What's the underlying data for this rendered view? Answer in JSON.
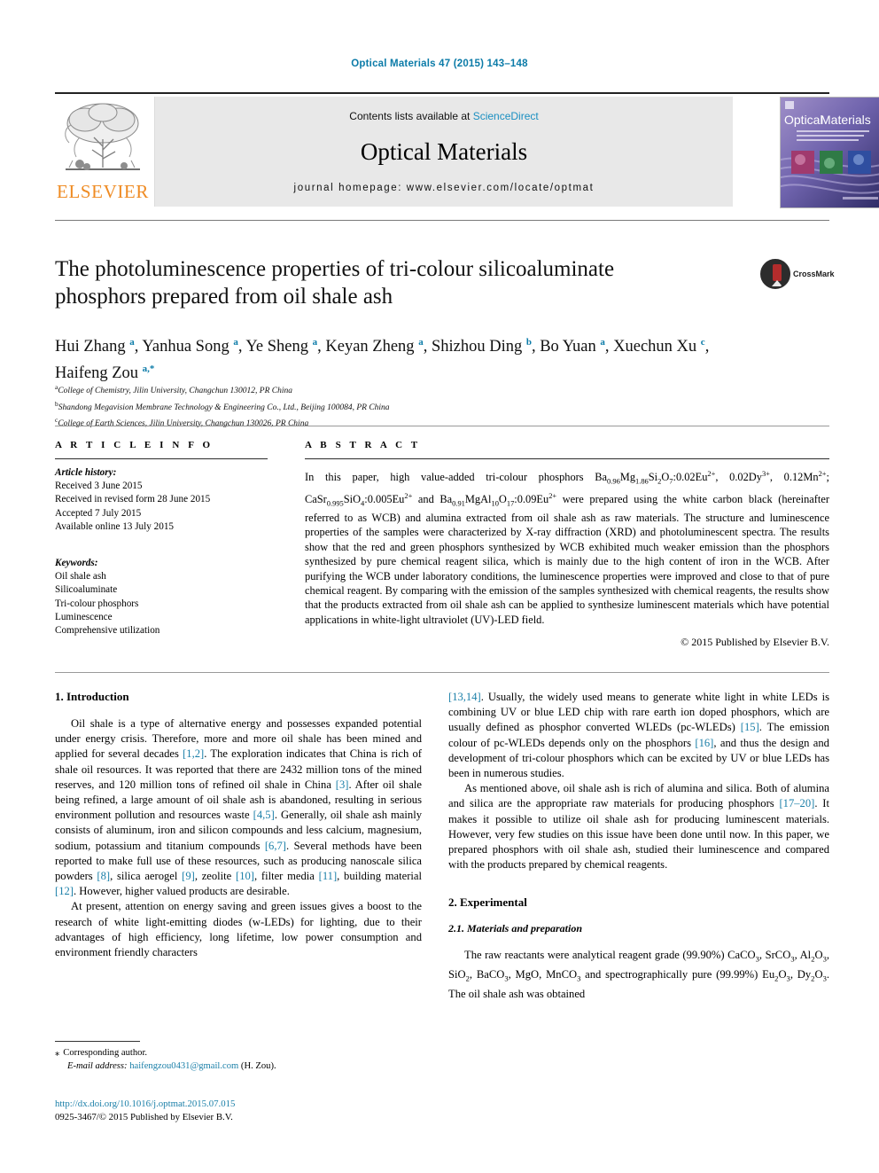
{
  "running_head": "Optical Materials 47 (2015) 143–148",
  "masthead": {
    "publisher": "ELSEVIER",
    "contents_prefix": "Contents lists available at ",
    "contents_link": "ScienceDirect",
    "journal_title": "Optical Materials",
    "homepage": "journal homepage: www.elsevier.com/locate/optmat",
    "cover_title": "Optical Materials"
  },
  "article": {
    "title": "The photoluminescence properties of tri-colour silicoaluminate phosphors prepared from oil shale ash",
    "crossmark_label": "CrossMark",
    "authors": [
      {
        "name": "Hui Zhang",
        "marks": "a"
      },
      {
        "name": "Yanhua Song",
        "marks": "a"
      },
      {
        "name": "Ye Sheng",
        "marks": "a"
      },
      {
        "name": "Keyan Zheng",
        "marks": "a"
      },
      {
        "name": "Shizhou Ding",
        "marks": "b"
      },
      {
        "name": "Bo Yuan",
        "marks": "a"
      },
      {
        "name": "Xuechun Xu",
        "marks": "c"
      },
      {
        "name": "Haifeng Zou",
        "marks": "a,*"
      }
    ],
    "affiliations": [
      {
        "mark": "a",
        "text": "College of Chemistry, Jilin University, Changchun 130012, PR China"
      },
      {
        "mark": "b",
        "text": "Shandong Megavision Membrane Technology & Engineering Co., Ltd., Beijing 100084, PR China"
      },
      {
        "mark": "c",
        "text": "College of Earth Sciences, Jilin University, Changchun 130026, PR China"
      }
    ]
  },
  "article_info": {
    "heading": "A R T I C L E   I N F O",
    "history_label": "Article history:",
    "history": [
      "Received 3 June 2015",
      "Received in revised form 28 June 2015",
      "Accepted 7 July 2015",
      "Available online 13 July 2015"
    ],
    "keywords_label": "Keywords:",
    "keywords": [
      "Oil shale ash",
      "Silicoaluminate",
      "Tri-colour phosphors",
      "Luminescence",
      "Comprehensive utilization"
    ]
  },
  "abstract": {
    "heading": "A B S T R A C T",
    "text_parts": [
      "In this paper, high value-added tri-colour phosphors Ba",
      "0.96",
      "Mg",
      "1.86",
      "Si",
      "2",
      "O",
      "7",
      ":0.02Eu",
      "2+",
      ", 0.02Dy",
      "3+",
      ", 0.12Mn",
      "2+",
      "; CaSr",
      "0.995",
      "SiO",
      "4",
      ":0.005Eu",
      "2+",
      " and Ba",
      "0.91",
      "MgAl",
      "10",
      "O",
      "17",
      ":0.09Eu",
      "2+",
      " were prepared using the white carbon black (hereinafter referred to as WCB) and alumina extracted from oil shale ash as raw materials. The structure and luminescence properties of the samples were characterized by X-ray diffraction (XRD) and photoluminescent spectra. The results show that the red and green phosphors synthesized by WCB exhibited much weaker emission than the phosphors synthesized by pure chemical reagent silica, which is mainly due to the high content of iron in the WCB. After purifying the WCB under laboratory conditions, the luminescence properties were improved and close to that of pure chemical reagent. By comparing with the emission of the samples synthesized with chemical reagents, the results show that the products extracted from oil shale ash can be applied to synthesize luminescent materials which have potential applications in white-light ultraviolet (UV)-LED field."
    ],
    "copyright": "© 2015 Published by Elsevier B.V."
  },
  "sections": {
    "introduction_heading": "1. Introduction",
    "intro_p1_a": "Oil shale is a type of alternative energy and possesses expanded potential under energy crisis. Therefore, more and more oil shale has been mined and applied for several decades ",
    "intro_p1_ref1": "[1,2]",
    "intro_p1_b": ". The exploration indicates that China is rich of shale oil resources. It was reported that there are 2432 million tons of the mined reserves, and 120 million tons of refined oil shale in China ",
    "intro_p1_ref2": "[3]",
    "intro_p1_c": ". After oil shale being refined, a large amount of oil shale ash is abandoned, resulting in serious environment pollution and resources waste ",
    "intro_p1_ref3": "[4,5]",
    "intro_p1_d": ". Generally, oil shale ash mainly consists of aluminum, iron and silicon compounds and less calcium, magnesium, sodium, potassium and titanium compounds ",
    "intro_p1_ref4": "[6,7]",
    "intro_p1_e": ". Several methods have been reported to make full use of these resources, such as producing nanoscale silica powders ",
    "intro_p1_ref5": "[8]",
    "intro_p1_f": ", silica aerogel ",
    "intro_p1_ref6": "[9]",
    "intro_p1_g": ", zeolite ",
    "intro_p1_ref7": "[10]",
    "intro_p1_h": ", filter media ",
    "intro_p1_ref8": "[11]",
    "intro_p1_i": ", building material ",
    "intro_p1_ref9": "[12]",
    "intro_p1_j": ". However, higher valued products are desirable.",
    "intro_p2_a": "At present, attention on energy saving and green issues gives a boost to the research of white light-emitting diodes (w-LEDs) for lighting, due to their advantages of high efficiency, long lifetime, low power consumption and environment friendly characters ",
    "intro_p2_ref1": "[13,14]",
    "intro_p2_b": ". Usually, the widely used means to generate white light in white LEDs is combining UV or blue LED chip with rare earth ion doped phosphors, which are usually defined as phosphor converted WLEDs (pc-WLEDs) ",
    "intro_p2_ref2": "[15]",
    "intro_p2_c": ". The emission colour of pc-WLEDs depends only on the phosphors ",
    "intro_p2_ref3": "[16]",
    "intro_p2_d": ", and thus the design and development of tri-colour phosphors which can be excited by UV or blue LEDs has been in numerous studies.",
    "intro_p3_a": "As mentioned above, oil shale ash is rich of alumina and silica. Both of alumina and silica are the appropriate raw materials for producing phosphors ",
    "intro_p3_ref1": "[17–20]",
    "intro_p3_b": ". It makes it possible to utilize oil shale ash for producing luminescent materials. However, very few studies on this issue have been done until now. In this paper, we prepared phosphors with oil shale ash, studied their luminescence and compared with the products prepared by chemical reagents.",
    "experimental_heading": "2. Experimental",
    "materials_heading": "2.1. Materials and preparation",
    "materials_p1_a": "The raw reactants were analytical reagent grade (99.90%) CaCO",
    "materials_sub1": "3",
    "materials_p1_b": ", SrCO",
    "materials_sub2": "3",
    "materials_p1_c": ", Al",
    "materials_sub3": "2",
    "materials_p1_d": "O",
    "materials_sub4": "3",
    "materials_p1_e": ", SiO",
    "materials_sub5": "2",
    "materials_p1_f": ", BaCO",
    "materials_sub6": "3",
    "materials_p1_g": ", MgO, MnCO",
    "materials_sub7": "3",
    "materials_p1_h": " and spectrographically pure (99.99%) Eu",
    "materials_sub8": "2",
    "materials_p1_i": "O",
    "materials_sub9": "3",
    "materials_p1_j": ", Dy",
    "materials_sub10": "2",
    "materials_p1_k": "O",
    "materials_sub11": "3",
    "materials_p1_l": ". The oil shale ash was obtained"
  },
  "footer": {
    "corresponding_star": "⁎",
    "corresponding_label": "Corresponding author.",
    "email_label": "E-mail address:",
    "email": "haifengzou0431@gmail.com",
    "email_suffix": "(H. Zou).",
    "doi": "http://dx.doi.org/10.1016/j.optmat.2015.07.015",
    "issn_line": "0925-3467/© 2015 Published by Elsevier B.V."
  },
  "colors": {
    "link": "#1a7fa8",
    "header": "#0b7ba8",
    "elsevier_orange": "#ef8b23",
    "banner_bg": "#e8e8e8"
  }
}
